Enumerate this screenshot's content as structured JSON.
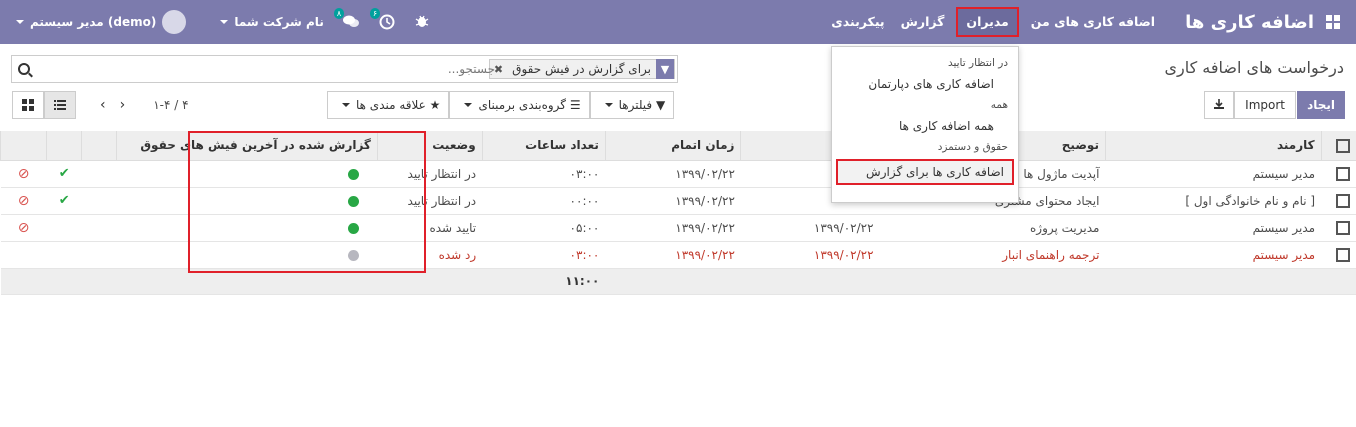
{
  "navbar": {
    "brand": "اضافه کاری ها",
    "menus": [
      "اضافه کاری های من",
      "مدیران",
      "گزارش",
      "پیکربندی"
    ],
    "user_name": "مدیر سیستم (demo)",
    "company": "نام شرکت شما",
    "messages_badge": "۸",
    "activity_badge": "۶"
  },
  "breadcrumb": "درخواست های اضافه کاری",
  "search": {
    "facet": "برای گزارش در فیش حقوق",
    "placeholder": "جستجو..."
  },
  "buttons": {
    "create": "ایجاد",
    "import": "Import"
  },
  "filters": {
    "filters_label": "فیلترها",
    "groupby_label": "گروه‌بندی برمبنای",
    "favorites_label": "علاقه مندی ها"
  },
  "pager": "۱-۴ / ۴",
  "dropdown": {
    "section1": "در انتظار تایید",
    "item1": "اضافه کاری های دپارتمان",
    "section2": "همه",
    "item2": "همه اضافه کاری ها",
    "section3": "حقوق و دستمزد",
    "item3": "اضافه کاری ها برای گزارش"
  },
  "table": {
    "headers": {
      "employee": "کارمند",
      "description": "توضیح",
      "end_time": "زمان اتمام",
      "hours": "تعداد ساعات",
      "status": "وضعیت",
      "payslip": "گزارش شده در آخرین فیش های حقوق"
    },
    "rows": [
      {
        "employee": "مدیر سیستم",
        "description": "آپدیت ماژول ها",
        "start": "",
        "end": "۱۳۹۹/۰۲/۲۲",
        "hours": "۰۳:۰۰",
        "status": "در انتظار تایید"
      },
      {
        "employee": "[ نام و نام خانوادگی اول ]",
        "description": "ایجاد محتوای مشتری",
        "start": "",
        "end": "۱۳۹۹/۰۲/۲۲",
        "hours": "۰۰:۰۰",
        "status": "در انتظار تایید"
      },
      {
        "employee": "مدیر سیستم",
        "description": "مدیریت پروژه",
        "start": "۱۳۹۹/۰۲/۲۲",
        "end": "۱۳۹۹/۰۲/۲۲",
        "hours": "۰۵:۰۰",
        "status": "تایید شده"
      },
      {
        "employee": "مدیر سیستم",
        "description": "ترجمه راهنمای انبار",
        "start": "۱۳۹۹/۰۲/۲۲",
        "end": "۱۳۹۹/۰۲/۲۲",
        "hours": "۰۳:۰۰",
        "status": "رد شده"
      }
    ],
    "total_hours": "۱۱:۰۰"
  }
}
